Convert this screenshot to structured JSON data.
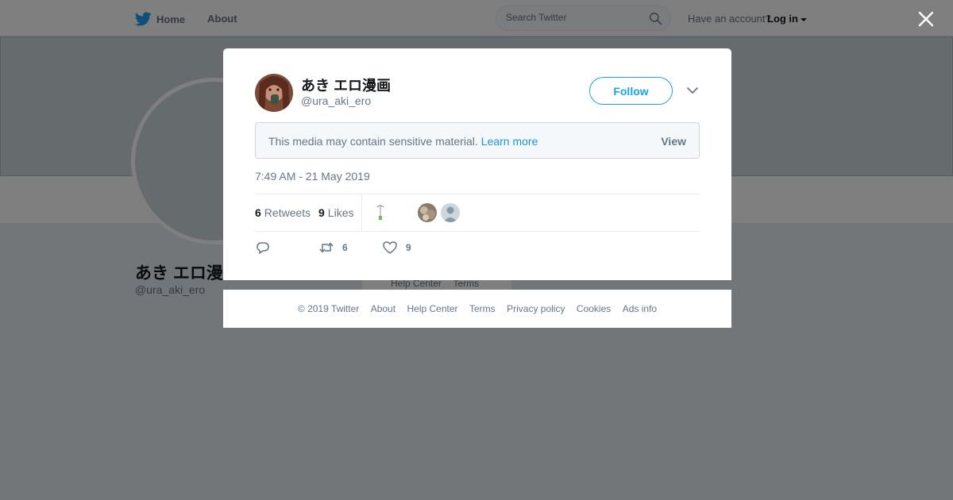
{
  "topbar": {
    "home_label": "Home",
    "about_label": "About",
    "search_placeholder": "Search Twitter",
    "account_prompt": "Have an account?",
    "login_label": "Log in",
    "brand_color": "#1da1f2"
  },
  "background_profile": {
    "name": "あき エロ漫",
    "handle": "@ura_aki_ero",
    "footer_links": [
      "Help Center",
      "Terms"
    ]
  },
  "tweet": {
    "author_name": "あき エロ漫画",
    "author_handle": "@ura_aki_ero",
    "follow_label": "Follow",
    "sensitive_notice": "This media may contain sensitive material.",
    "learn_more_label": "Learn more",
    "view_label": "View",
    "timestamp": "7:49 AM - 21 May 2019",
    "retweets_count": "6",
    "retweets_label": "Retweets",
    "likes_count": "9",
    "likes_label": "Likes",
    "actions": {
      "reply_count": "",
      "retweet_count": "6",
      "like_count": "9"
    }
  },
  "footer": {
    "links": [
      "© 2019 Twitter",
      "About",
      "Help Center",
      "Terms",
      "Privacy policy",
      "Cookies",
      "Ads info"
    ]
  },
  "icons": {
    "brand": "twitter-bird-icon",
    "search": "search-icon",
    "close": "close-icon",
    "more": "chevron-down-icon",
    "reply": "reply-icon",
    "retweet": "retweet-icon",
    "like": "heart-icon"
  }
}
